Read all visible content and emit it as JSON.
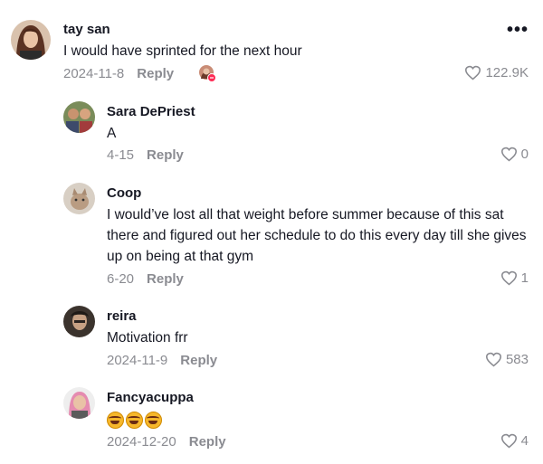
{
  "colors": {
    "text": "#161823",
    "muted": "#8a8b91"
  },
  "comments": [
    {
      "username": "tay san",
      "text": "I would have sprinted for the next hour",
      "date": "2024-11-8",
      "reply": "Reply",
      "likes": "122.9K",
      "more_icon": "•••"
    },
    {
      "username": "Sara DePriest",
      "text": "A",
      "date": "4-15",
      "reply": "Reply",
      "likes": "0"
    },
    {
      "username": "Coop",
      "text": "I would’ve lost all that weight before summer because of this sat there and figured out her schedule to do this every day till she gives up on being at that gym",
      "date": "6-20",
      "reply": "Reply",
      "likes": "1"
    },
    {
      "username": "reira",
      "text": "Motivation frr",
      "date": "2024-11-9",
      "reply": "Reply",
      "likes": "583"
    },
    {
      "username": "Fancyacuppa",
      "text": "",
      "emoji_icons": [
        "rofl-emoji-icon",
        "rofl-emoji-icon",
        "rofl-emoji-icon"
      ],
      "date": "2024-12-20",
      "reply": "Reply",
      "likes": "4"
    }
  ]
}
